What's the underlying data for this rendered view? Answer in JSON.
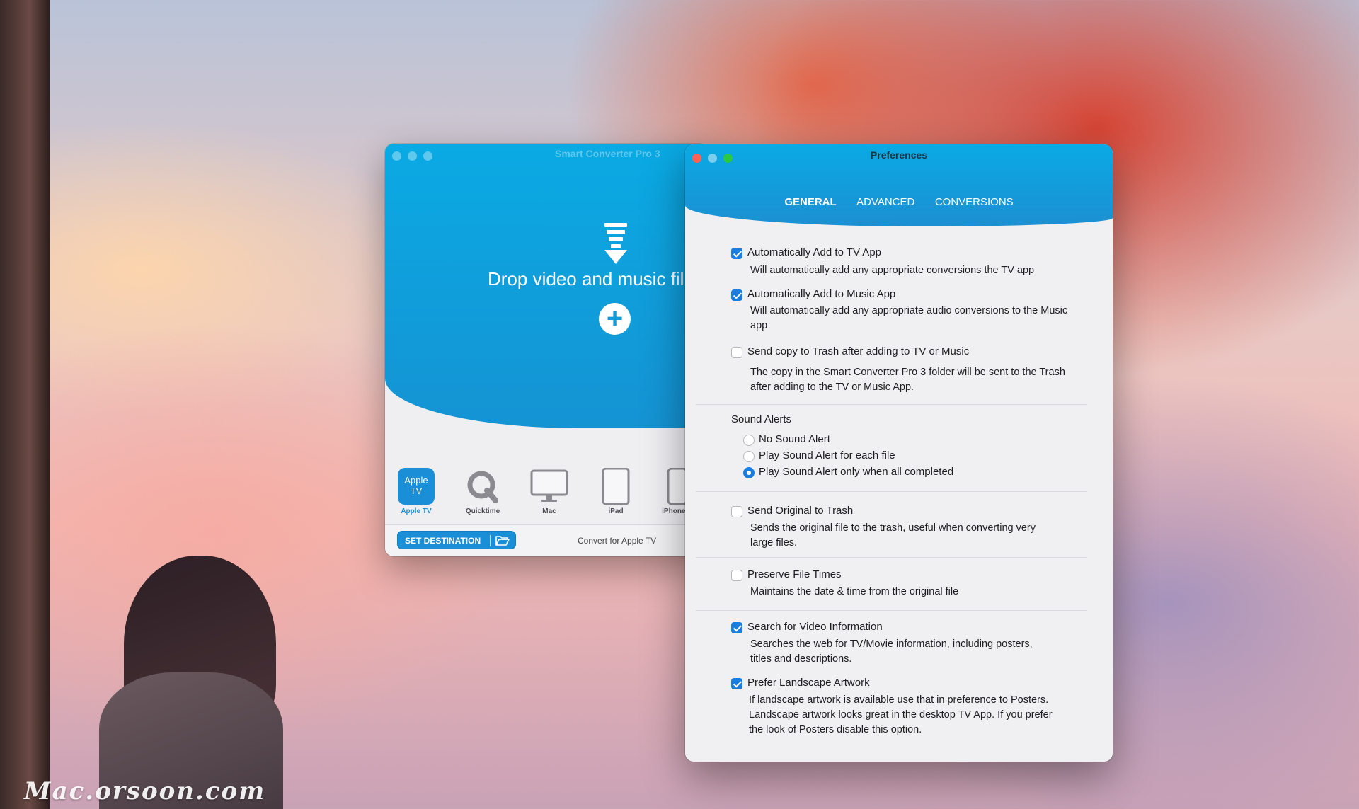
{
  "watermark": "Mac.orsoon.com",
  "converter": {
    "title": "Smart Converter Pro 3",
    "drop_text": "Drop video and music fil",
    "devices": [
      {
        "label": "Apple TV",
        "tile_text": "Apple TV",
        "icon": "apple-tv-icon",
        "active": true
      },
      {
        "label": "Quicktime",
        "icon": "quicktime-icon"
      },
      {
        "label": "Mac",
        "icon": "mac-monitor-icon"
      },
      {
        "label": "iPad",
        "icon": "ipad-icon"
      },
      {
        "label": "iPhone c",
        "icon": "iphone-icon"
      }
    ],
    "set_destination": "SET DESTINATION",
    "convert_for": "Convert for Apple TV",
    "accent": "#1a8fd8"
  },
  "prefs": {
    "title": "Preferences",
    "tabs": [
      {
        "label": "GENERAL",
        "active": true
      },
      {
        "label": "ADVANCED"
      },
      {
        "label": "CONVERSIONS"
      }
    ],
    "options": [
      {
        "label": "Automatically Add to TV App",
        "checked": true,
        "desc": "Will automatically add any appropriate conversions the TV app"
      },
      {
        "label": "Automatically Add to Music App",
        "checked": true,
        "desc": "Will automatically add any appropriate audio conversions to the Music app"
      },
      {
        "label": "Send copy to Trash after adding to TV or Music",
        "checked": false,
        "desc": "The copy in the Smart Converter Pro 3 folder will be sent to the Trash after adding to the TV or Music App."
      }
    ],
    "sound_alerts": {
      "title": "Sound Alerts",
      "options": [
        {
          "label": "No Sound Alert",
          "selected": false
        },
        {
          "label": "Play Sound Alert for each file",
          "selected": false
        },
        {
          "label": "Play Sound Alert only when all completed",
          "selected": true
        }
      ]
    },
    "send_original": {
      "label": "Send Original to Trash",
      "checked": false,
      "desc": "Sends the original file to the trash, useful when converting very large files."
    },
    "preserve_times": {
      "label": "Preserve File Times",
      "checked": false,
      "desc": "Maintains the date & time from the original file"
    },
    "search_video": {
      "label": "Search for Video Information",
      "checked": true,
      "desc": "Searches the web for TV/Movie information, including posters, titles and descriptions."
    },
    "landscape": {
      "label": "Prefer Landscape Artwork",
      "checked": true,
      "desc": "If landscape artwork is available use that in preference to Posters. Landscape artwork looks great in the desktop TV App. If you prefer the look of Posters disable this option."
    },
    "accent": "#1a7ee0"
  }
}
